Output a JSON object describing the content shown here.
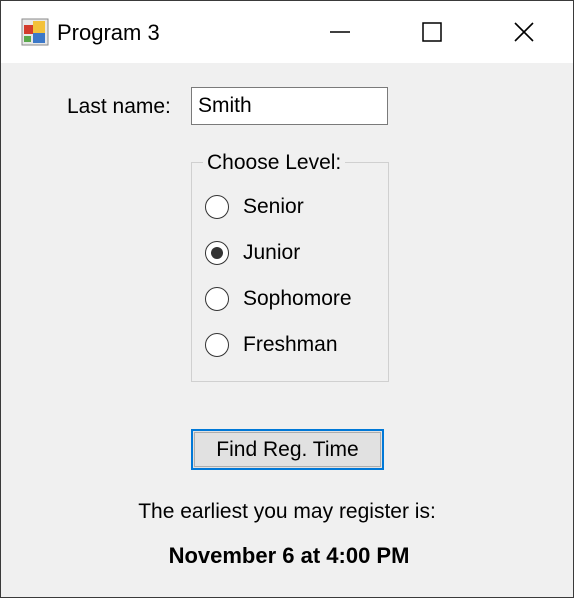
{
  "window": {
    "title": "Program 3",
    "icon": "app-form-icon",
    "controls": [
      "minimize-icon",
      "maximize-icon",
      "close-icon"
    ]
  },
  "form": {
    "last_name_label": "Last name:",
    "last_name_value": "Smith",
    "level_group_title": "Choose Level:",
    "levels": [
      {
        "label": "Senior",
        "checked": false
      },
      {
        "label": "Junior",
        "checked": true
      },
      {
        "label": "Sophomore",
        "checked": false
      },
      {
        "label": "Freshman",
        "checked": false
      }
    ],
    "find_button_label": "Find Reg. Time",
    "info_text": "The earliest you may register is:",
    "result_text": "November 6 at 4:00 PM"
  },
  "colors": {
    "titlebar": "#ffffff",
    "client": "#f0f0f0",
    "focus_border": "#0078d7"
  }
}
